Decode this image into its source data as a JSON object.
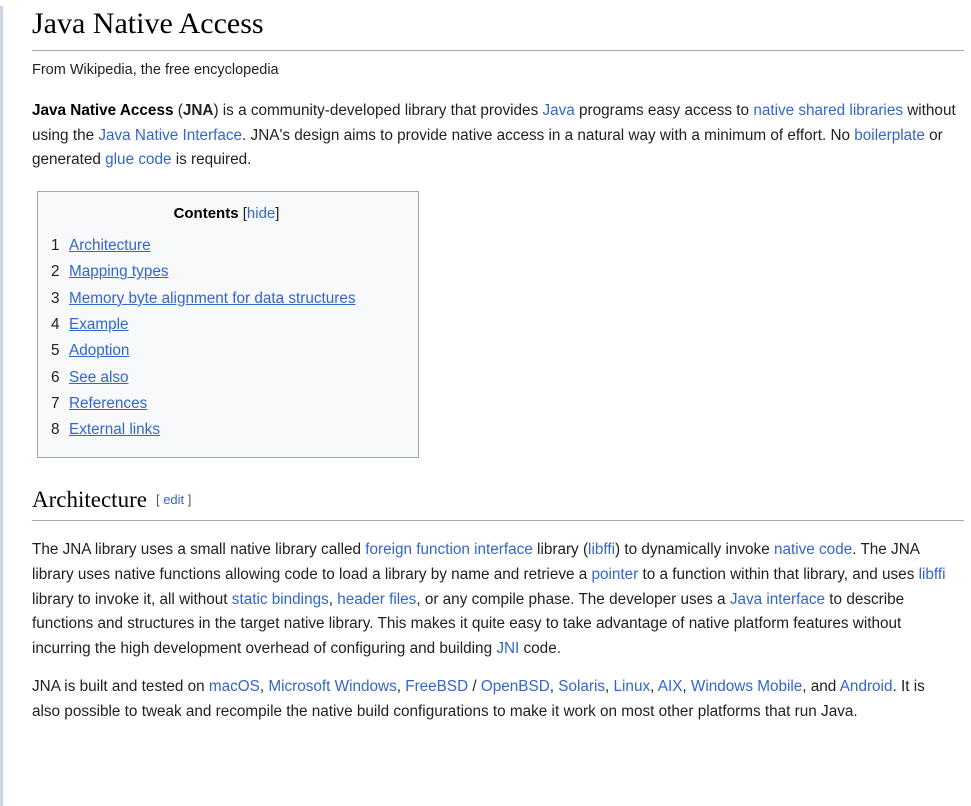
{
  "page": {
    "title": "Java Native Access",
    "subtitle": "From Wikipedia, the free encyclopedia"
  },
  "colors": {
    "link": "#3366cc",
    "text": "#202122",
    "rule": "#a2a9b1",
    "toc_background": "#f8f9fa",
    "left_border": "#c8d7e6"
  },
  "intro": {
    "p1": {
      "bold_title": "Java Native Access",
      "s1": " (",
      "abbr": "JNA",
      "s2": ") is a community-developed library that provides ",
      "link_java": "Java",
      "s3": " programs easy access to ",
      "link_native_shared_libraries": "native shared libraries",
      "s4": " without using the ",
      "link_jni_full": "Java Native Interface",
      "s5": ". JNA's design aims to provide native access in a natural way with a minimum of effort. No ",
      "link_boilerplate": "boilerplate",
      "s6": " or generated ",
      "link_glue_code": "glue code",
      "s7": " is required."
    }
  },
  "toc": {
    "title_label": "Contents",
    "toggle_open": "[",
    "toggle_label": "hide",
    "toggle_close": "]",
    "items": [
      {
        "number": "1",
        "label": "Architecture"
      },
      {
        "number": "2",
        "label": "Mapping types"
      },
      {
        "number": "3",
        "label": "Memory byte alignment for data structures"
      },
      {
        "number": "4",
        "label": "Example"
      },
      {
        "number": "5",
        "label": "Adoption"
      },
      {
        "number": "6",
        "label": "See also"
      },
      {
        "number": "7",
        "label": "References"
      },
      {
        "number": "8",
        "label": "External links"
      }
    ]
  },
  "sections": [
    {
      "heading": "Architecture",
      "edit_open": "[",
      "edit_label": "edit",
      "edit_close": "]",
      "p1": {
        "s1": "The JNA library uses a small native library called ",
        "link_ffi": "foreign function interface",
        "s2": " library (",
        "link_libffi_1": "libffi",
        "s3": ") to dynamically invoke ",
        "link_native_code": "native code",
        "s4": ". The JNA library uses native functions allowing code to load a library by name and retrieve a ",
        "link_pointer": "pointer",
        "s5": " to a function within that library, and uses ",
        "link_libffi_2": "libffi",
        "s6": " library to invoke it, all without ",
        "link_static_bindings": "static bindings",
        "s7": ", ",
        "link_header_files": "header files",
        "s8": ", or any compile phase. The developer uses a ",
        "link_java_interface": "Java interface",
        "s9": " to describe functions and structures in the target native library. This makes it quite easy to take advantage of native platform features without incurring the high development overhead of configuring and building ",
        "link_jni": "JNI",
        "s10": " code."
      },
      "p2": {
        "s1": "JNA is built and tested on ",
        "link_macos": "macOS",
        "s2": ", ",
        "link_microsoft_windows": "Microsoft Windows",
        "s3": ", ",
        "link_freebsd": "FreeBSD",
        "s4": " / ",
        "link_openbsd": "OpenBSD",
        "s5": ", ",
        "link_solaris": "Solaris",
        "s6": ", ",
        "link_linux": "Linux",
        "s7": ", ",
        "link_aix": "AIX",
        "s8": ", ",
        "link_windows_mobile": "Windows Mobile",
        "s9": ", and ",
        "link_android": "Android",
        "s10": ". It is also possible to tweak and recompile the native build configurations to make it work on most other platforms that run Java."
      }
    }
  ]
}
